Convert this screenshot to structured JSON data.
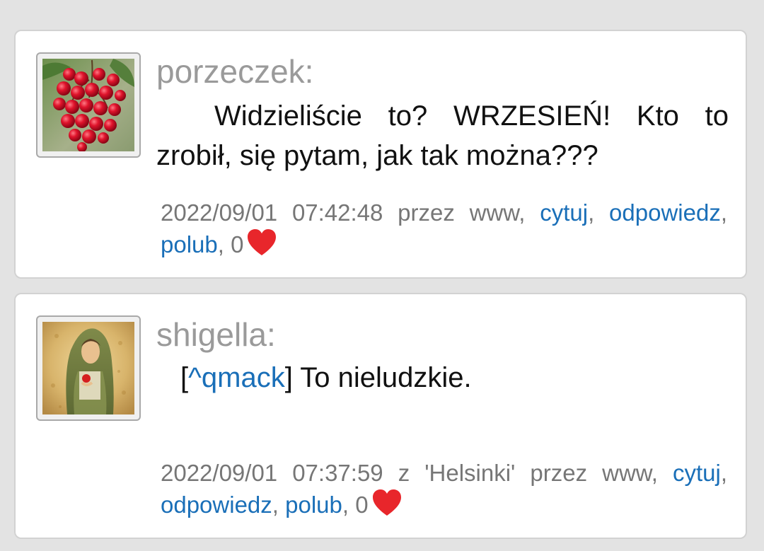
{
  "colors": {
    "page_background": "#e3e3e3",
    "card_background": "#ffffff",
    "author_text": "#9a9a9a",
    "meta_text": "#767676",
    "link": "#1a6fb8",
    "heart": "#e8262b"
  },
  "posts": [
    {
      "avatar_icon": "red-currant-berries-icon",
      "author": "porzeczek:",
      "message": "Widzieliście to? WRZESIEŃ! Kto to zrobił, się pytam, jak tak można???",
      "date": "2022/09/01",
      "time": "07:42:48",
      "location": "",
      "via": "przez www,",
      "quote_label": "cytuj",
      "reply_label": "odpowiedz",
      "like_label": "polub",
      "like_count": "0",
      "heart_icon": "heart-icon"
    },
    {
      "avatar_icon": "woman-with-apple-painting-icon",
      "author": "shigella:",
      "mention": "^qmack",
      "message": "To nieludzkie.",
      "date": "2022/09/01",
      "time": "07:37:59",
      "location": "z 'Helsinki'",
      "via": "przez www,",
      "quote_label": "cytuj",
      "reply_label": "odpowiedz",
      "like_label": "polub",
      "like_count": "0",
      "heart_icon": "heart-icon"
    }
  ]
}
